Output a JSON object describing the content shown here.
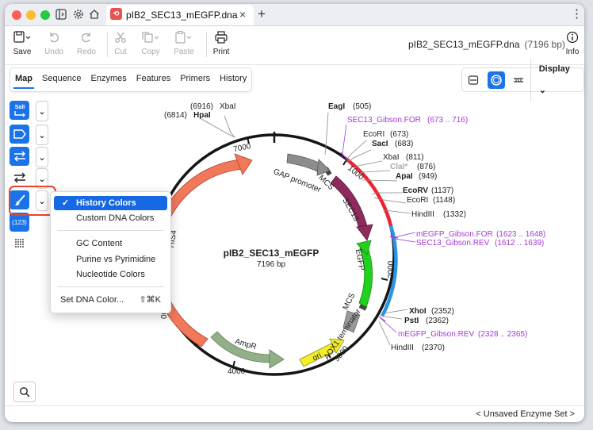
{
  "window": {
    "tab_title": "pIB2_SEC13_mEGFP.dna",
    "tab_close": "×",
    "new_tab": "+",
    "menu_dots": "⋮"
  },
  "toolbar": {
    "save": "Save",
    "undo": "Undo",
    "redo": "Redo",
    "cut": "Cut",
    "copy": "Copy",
    "paste": "Paste",
    "print": "Print",
    "info": "Info",
    "doc_name": "pIB2_SEC13_mEGFP.dna",
    "doc_size": "(7196 bp)"
  },
  "tabs": [
    "Map",
    "Sequence",
    "Enzymes",
    "Features",
    "Primers",
    "History"
  ],
  "active_tab": "Map",
  "view": {
    "display_label": "Display"
  },
  "sidebar": {
    "sali_label": "SalI",
    "num_label": "(123)"
  },
  "color_menu": {
    "items": [
      {
        "label": "History Colors",
        "checked": "✓"
      },
      {
        "label": "Custom DNA Colors"
      },
      {
        "label": "GC Content"
      },
      {
        "label": "Purine vs Pyrimidine"
      },
      {
        "label": "Nucleotide Colors"
      },
      {
        "label": "Set DNA Color...",
        "shortcut": "⇧⌘K"
      }
    ]
  },
  "map": {
    "name": "pIB2_SEC13_mEGFP",
    "size": "7196 bp",
    "ticks": [
      "7000",
      "1000",
      "2000",
      "3000",
      "4000",
      "00"
    ],
    "features": {
      "gap": "GAP promoter",
      "mcs1": "MCS",
      "sec13": "SEC13",
      "egfp": "EGFP",
      "mcs2": "MCS",
      "aox1": "AOX1 terminator",
      "ori": "ori",
      "ampr": "AmpR",
      "his4": "HIS4"
    },
    "sites": [
      {
        "name": "XbaI",
        "pos": "(6916)"
      },
      {
        "name": "HpaI",
        "pos": "(6814)"
      },
      {
        "name": "EagI",
        "pos": "(505)"
      },
      {
        "name": "SEC13_Gibson.FOR",
        "pos": "(673 .. 716)"
      },
      {
        "name": "EcoRI",
        "pos": "(673)"
      },
      {
        "name": "SacI",
        "pos": "(683)"
      },
      {
        "name": "XbaI",
        "pos": "(811)"
      },
      {
        "name": "ClaI*",
        "pos": "(876)"
      },
      {
        "name": "ApaI",
        "pos": "(949)"
      },
      {
        "name": "EcoRV",
        "pos": "(1137)"
      },
      {
        "name": "EcoRI",
        "pos": "(1148)"
      },
      {
        "name": "HindIII",
        "pos": "(1332)"
      },
      {
        "name": "mEGFP_Gibson.FOR",
        "pos": "(1623 .. 1648)"
      },
      {
        "name": "SEC13_Gibson.REV",
        "pos": "(1612 .. 1639)"
      },
      {
        "name": "XhoI",
        "pos": "(2352)"
      },
      {
        "name": "PstI",
        "pos": "(2362)"
      },
      {
        "name": "mEGFP_Gibson.REV",
        "pos": "(2328 .. 2365)"
      },
      {
        "name": "HindIII",
        "pos": "(2370)"
      }
    ]
  },
  "footer": {
    "enzyme_set": "< Unsaved Enzyme Set >"
  }
}
